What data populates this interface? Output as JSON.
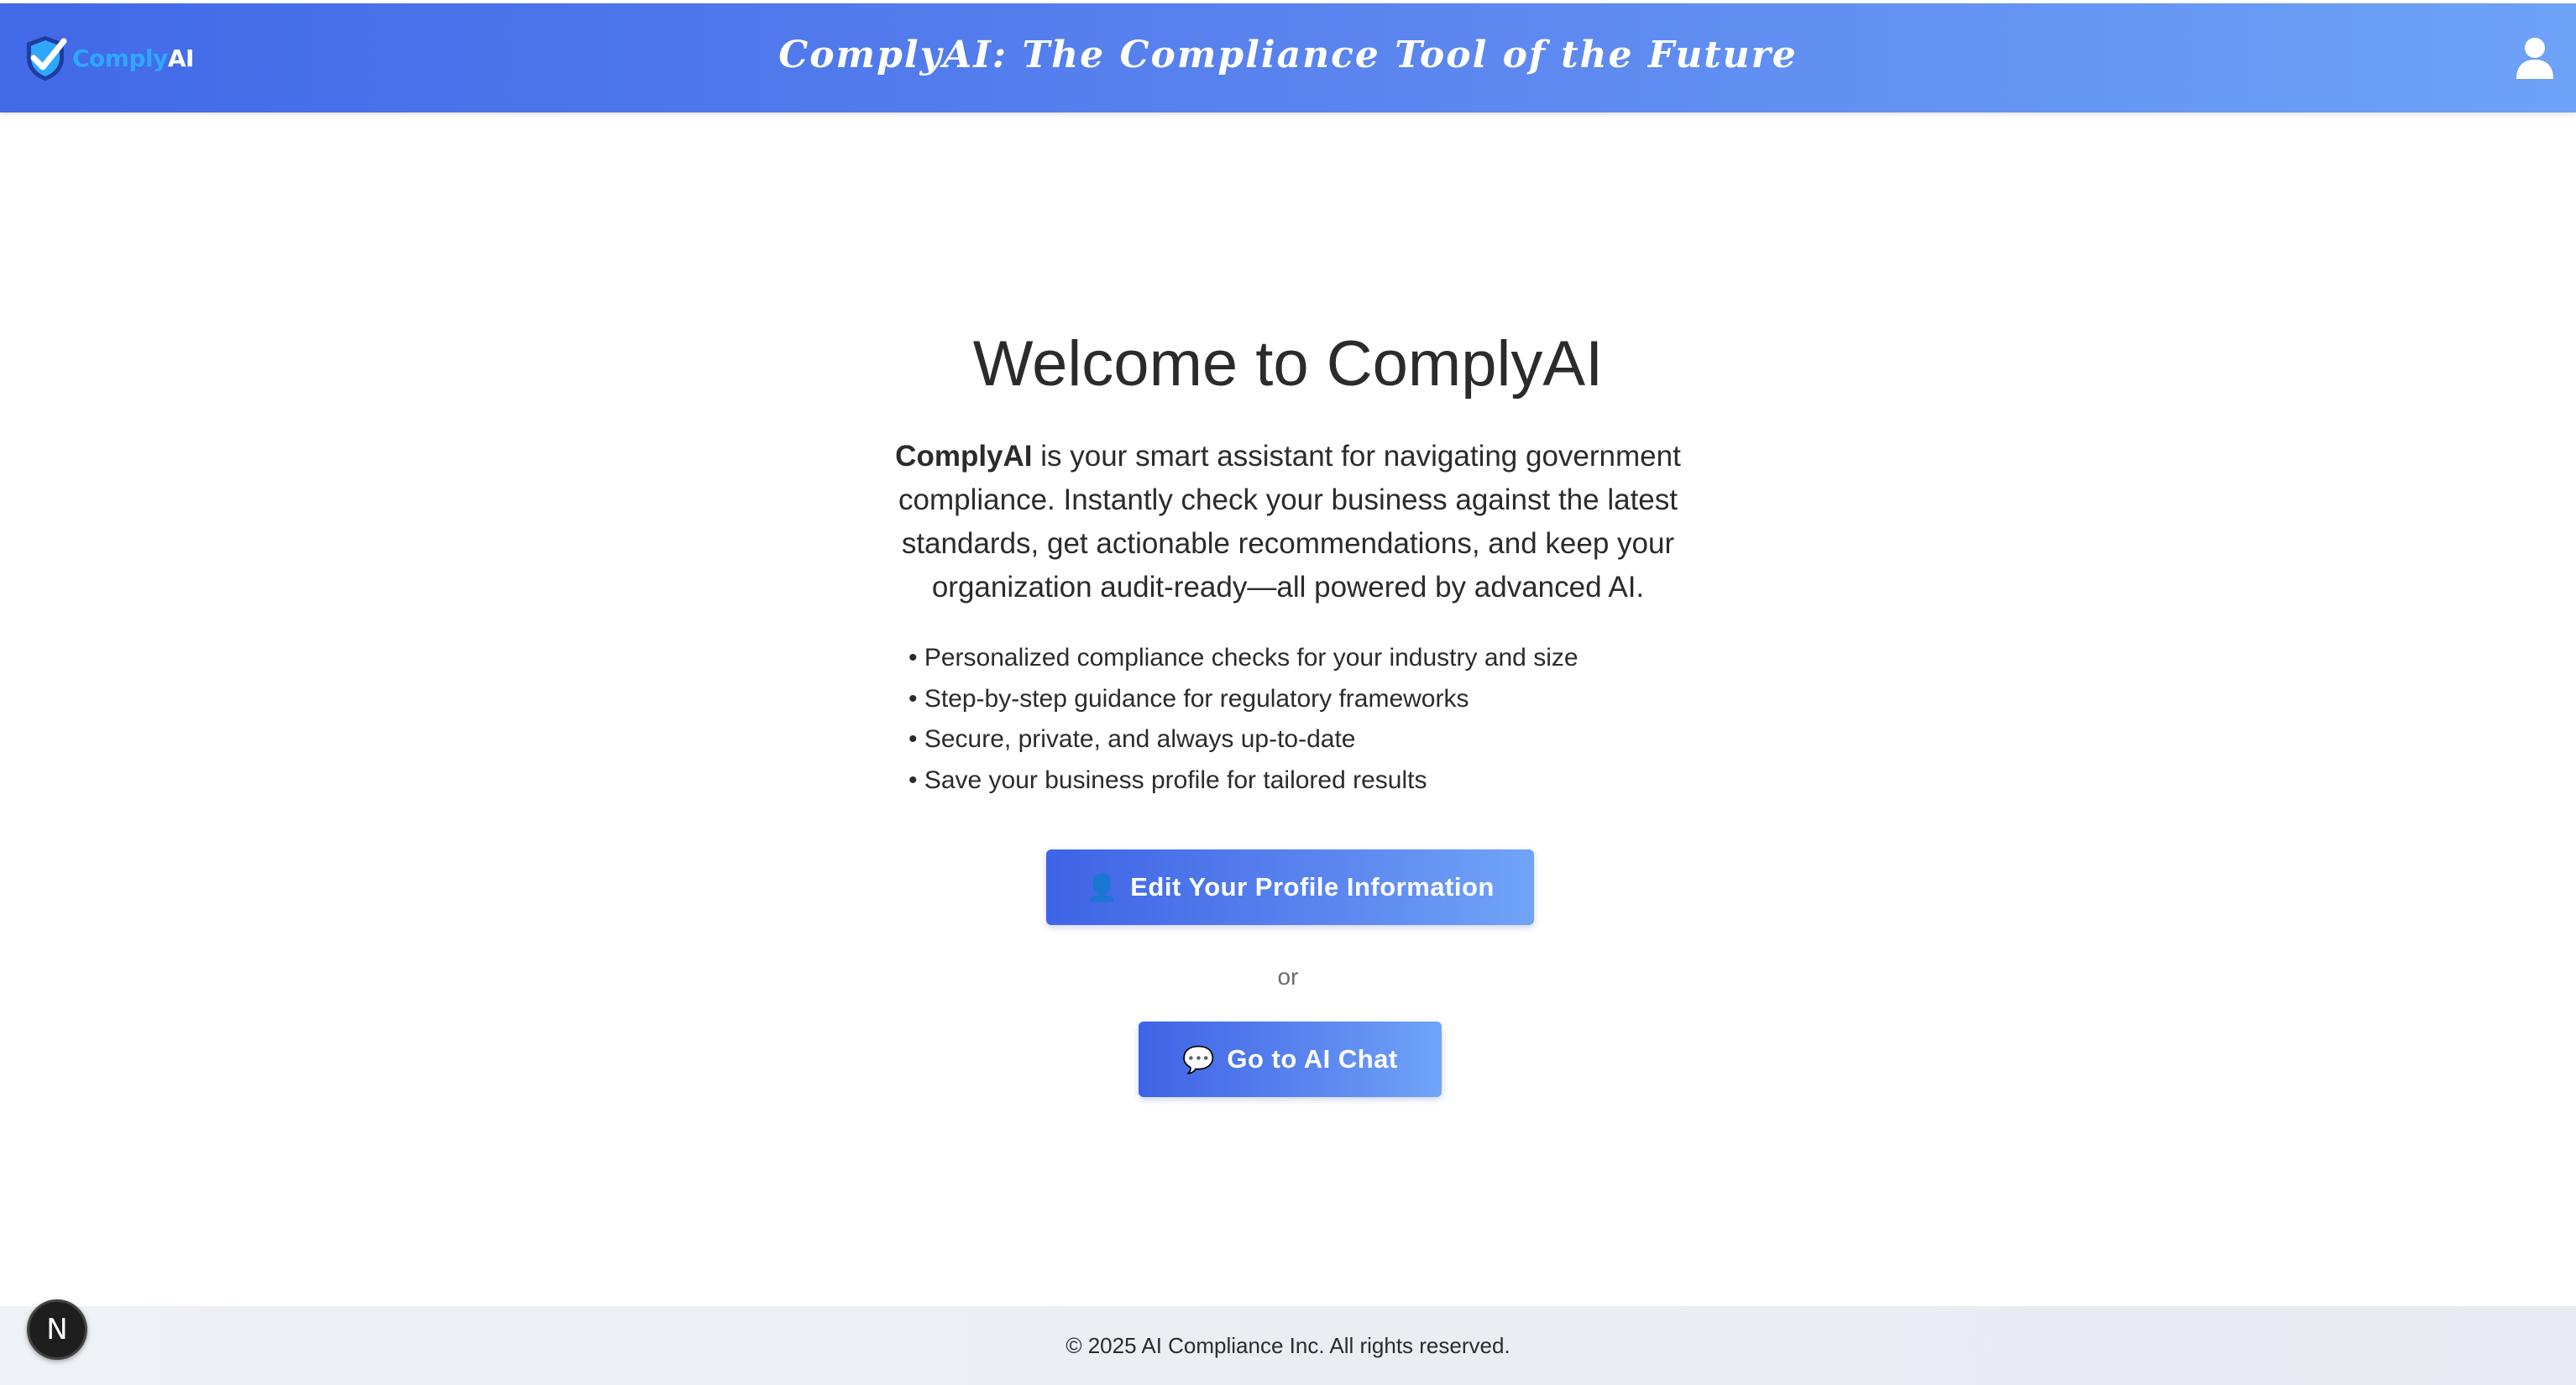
{
  "header": {
    "logo": {
      "part1": "Comply",
      "part2": "AI",
      "icon": "shield-check-icon"
    },
    "title": "ComplyAI: The Compliance Tool of the Future",
    "user_icon": "user-icon"
  },
  "main": {
    "title": "Welcome to ComplyAI",
    "intro_brand": "ComplyAI",
    "intro_text": " is your smart assistant for navigating government compliance. Instantly check your business against the latest standards, get actionable recommendations, and keep your organization audit-ready—all powered by advanced AI.",
    "features": [
      "Personalized compliance checks for your industry and size",
      "Step-by-step guidance for regulatory frameworks",
      "Secure, private, and always up-to-date",
      "Save your business profile for tailored results"
    ],
    "profile_button": {
      "icon": "👤",
      "label": "Edit Your Profile Information"
    },
    "or_label": "or",
    "chat_button": {
      "icon": "💬",
      "label": "Go to AI Chat"
    }
  },
  "footer": {
    "text": "© 2025 AI Compliance Inc. All rights reserved."
  },
  "dev_badge": {
    "label": "N"
  },
  "colors": {
    "header_gradient_start": "#4169e8",
    "header_gradient_end": "#6ea2f7",
    "button_gradient_start": "#3e63e6",
    "button_gradient_end": "#70a4f8",
    "logo_accent": "#2fa7ff"
  }
}
